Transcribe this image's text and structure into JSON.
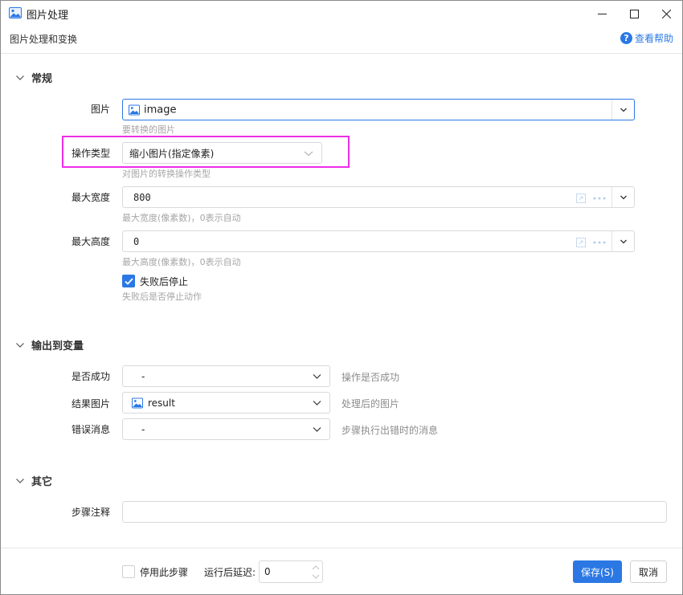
{
  "window": {
    "title": "图片处理",
    "subtitle": "图片处理和变换",
    "help_label": "查看帮助",
    "help_glyph": "?",
    "accent_color": "#2b78e4",
    "highlight_color": "#ee2ee8"
  },
  "general": {
    "header": "常规",
    "image": {
      "label": "图片",
      "value": "image",
      "hint": "要转换的图片"
    },
    "operation": {
      "label": "操作类型",
      "value": "缩小图片(指定像素)",
      "hint": "对图片的转换操作类型"
    },
    "max_width": {
      "label": "最大宽度",
      "value": "800",
      "hint": "最大宽度(像素数)，0表示自动"
    },
    "max_height": {
      "label": "最大高度",
      "value": "0",
      "hint": "最大高度(像素数)，0表示自动"
    },
    "stop_on_fail": {
      "label": "失败后停止",
      "checked": true,
      "hint": "失败后是否停止动作"
    }
  },
  "output": {
    "header": "输出到变量",
    "success": {
      "label": "是否成功",
      "value": "-",
      "hint": "操作是否成功"
    },
    "result_image": {
      "label": "结果图片",
      "value": "result",
      "hint": "处理后的图片"
    },
    "error_message": {
      "label": "错误消息",
      "value": "-",
      "hint": "步骤执行出错时的消息"
    }
  },
  "other": {
    "header": "其它",
    "step_note": {
      "label": "步骤注释",
      "value": ""
    }
  },
  "footer": {
    "disable_step": {
      "label": "停用此步骤",
      "checked": false
    },
    "delay": {
      "label": "运行后延迟:",
      "value": "0"
    },
    "save_label": "保存(S)",
    "cancel_label": "取消"
  }
}
